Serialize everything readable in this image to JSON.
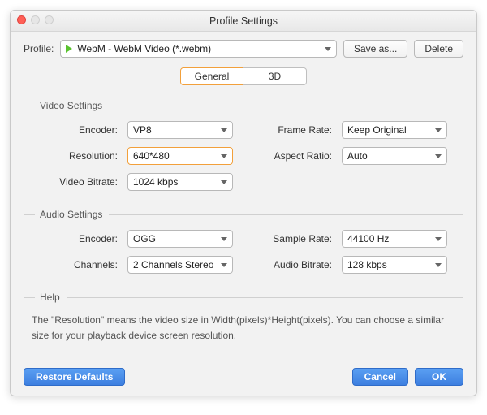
{
  "window": {
    "title": "Profile Settings"
  },
  "profile": {
    "label": "Profile:",
    "value": "WebM - WebM Video (*.webm)",
    "saveAs": "Save as...",
    "delete": "Delete"
  },
  "tabs": {
    "general": "General",
    "threeD": "3D"
  },
  "video": {
    "legend": "Video Settings",
    "encoderLabel": "Encoder:",
    "encoder": "VP8",
    "resolutionLabel": "Resolution:",
    "resolution": "640*480",
    "bitrateLabel": "Video Bitrate:",
    "bitrate": "1024 kbps",
    "frameRateLabel": "Frame Rate:",
    "frameRate": "Keep Original",
    "aspectLabel": "Aspect Ratio:",
    "aspect": "Auto"
  },
  "audio": {
    "legend": "Audio Settings",
    "encoderLabel": "Encoder:",
    "encoder": "OGG",
    "channelsLabel": "Channels:",
    "channels": "2 Channels Stereo",
    "sampleLabel": "Sample Rate:",
    "sample": "44100 Hz",
    "bitrateLabel": "Audio Bitrate:",
    "bitrate": "128 kbps"
  },
  "help": {
    "legend": "Help",
    "text": "The \"Resolution\" means the video size in Width(pixels)*Height(pixels).  You can choose a similar size for your playback device screen resolution."
  },
  "buttons": {
    "restore": "Restore Defaults",
    "cancel": "Cancel",
    "ok": "OK"
  }
}
